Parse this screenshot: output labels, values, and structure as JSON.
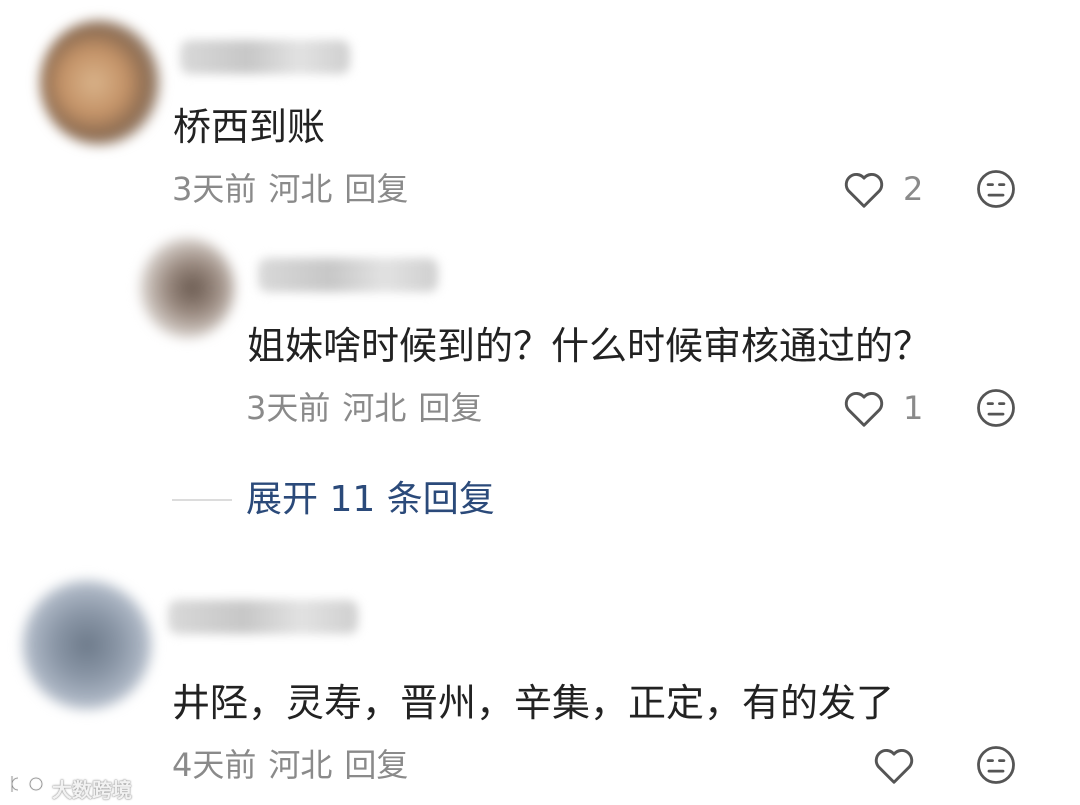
{
  "comments": [
    {
      "text": "桥西到账",
      "time": "3天前",
      "location": "河北",
      "reply_label": "回复",
      "likes": "2"
    },
    {
      "text": "姐妹啥时候到的？什么时候审核通过的？",
      "time": "3天前",
      "location": "河北",
      "reply_label": "回复",
      "likes": "1"
    },
    {
      "text": "井陉，灵寿，晋州，辛集，正定，有的发了",
      "time": "4天前",
      "location": "河北",
      "reply_label": "回复",
      "likes": ""
    }
  ],
  "expand_replies": "展开 11 条回复",
  "watermark": "大数跨境",
  "icons": {
    "like": "heart-outline-icon",
    "dislike": "neutral-face-icon"
  },
  "colors": {
    "text": "#222222",
    "meta": "#8a8a8a",
    "expand": "#2b4a7a",
    "icon": "#555555"
  }
}
